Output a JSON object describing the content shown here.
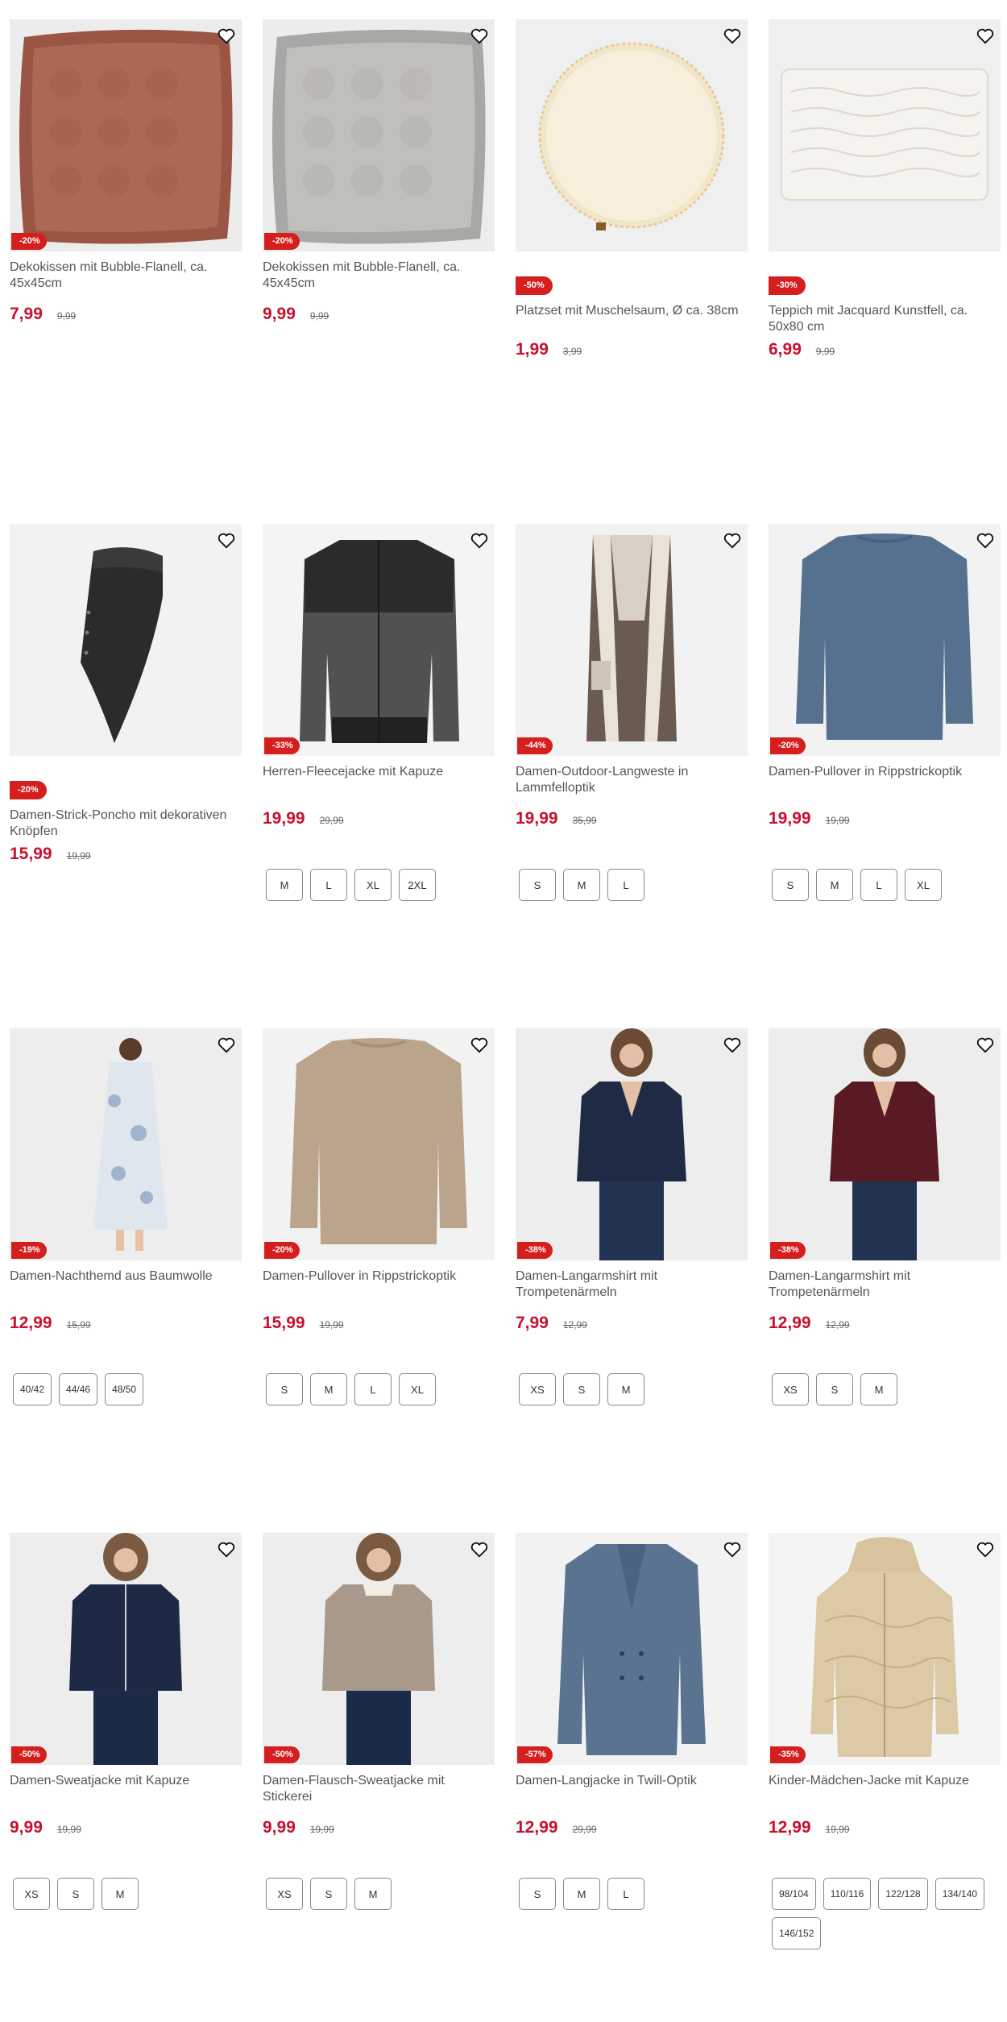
{
  "products": [
    {
      "title": "Dekokissen mit Bubble-Flanell, ca. 45x45cm",
      "badge": "-20%",
      "price": "7,99",
      "old_price": "9,99",
      "sizes": []
    },
    {
      "title": "Dekokissen mit Bubble-Flanell, ca. 45x45cm",
      "badge": "-20%",
      "price": "9,99",
      "old_price": "9,99",
      "sizes": []
    },
    {
      "title": "Platzset mit Muschelsaum, Ø ca. 38cm",
      "badge": "-50%",
      "price": "1,99",
      "old_price": "3,99",
      "sizes": []
    },
    {
      "title": "Teppich mit Jacquard Kunstfell, ca. 50x80 cm",
      "badge": "-30%",
      "price": "6,99",
      "old_price": "9,99",
      "sizes": []
    },
    {
      "title": "Damen-Strick-Poncho mit dekorativen Knöpfen",
      "badge": "-20%",
      "price": "15,99",
      "old_price": "19,99",
      "sizes": []
    },
    {
      "title": "Herren-Fleecejacke mit Kapuze",
      "badge": "-33%",
      "price": "19,99",
      "old_price": "29,99",
      "sizes": [
        "M",
        "L",
        "XL",
        "2XL"
      ]
    },
    {
      "title": "Damen-Outdoor-Langweste in Lammfelloptik",
      "badge": "-44%",
      "price": "19,99",
      "old_price": "35,99",
      "sizes": [
        "S",
        "M",
        "L"
      ]
    },
    {
      "title": "Damen-Pullover in Rippstrickoptik",
      "badge": "-20%",
      "price": "19,99",
      "old_price": "19,99",
      "sizes": [
        "S",
        "M",
        "L",
        "XL"
      ]
    },
    {
      "title": "Damen-Nachthemd aus Baumwolle",
      "badge": "-19%",
      "price": "12,99",
      "old_price": "15,99",
      "sizes": [
        "40/42",
        "44/46",
        "48/50"
      ]
    },
    {
      "title": "Damen-Pullover in Rippstrickoptik",
      "badge": "-20%",
      "price": "15,99",
      "old_price": "19,99",
      "sizes": [
        "S",
        "M",
        "L",
        "XL"
      ]
    },
    {
      "title": "Damen-Langarmshirt mit Trompetenärmeln",
      "badge": "-38%",
      "price": "7,99",
      "old_price": "12,99",
      "sizes": [
        "XS",
        "S",
        "M"
      ]
    },
    {
      "title": "Damen-Langarmshirt mit Trompetenärmeln",
      "badge": "-38%",
      "price": "12,99",
      "old_price": "12,99",
      "sizes": [
        "XS",
        "S",
        "M"
      ]
    },
    {
      "title": "Damen-Sweatjacke mit Kapuze",
      "badge": "-50%",
      "price": "9,99",
      "old_price": "19,99",
      "sizes": [
        "XS",
        "S",
        "M"
      ]
    },
    {
      "title": "Damen-Flausch-Sweatjacke mit Stickerei",
      "badge": "-50%",
      "price": "9,99",
      "old_price": "19,99",
      "sizes": [
        "XS",
        "S",
        "M"
      ]
    },
    {
      "title": "Damen-Langjacke in Twill-Optik",
      "badge": "-57%",
      "price": "12,99",
      "old_price": "29,99",
      "sizes": [
        "S",
        "M",
        "L"
      ]
    },
    {
      "title": "Kinder-Mädchen-Jacke mit Kapuze",
      "badge": "-35%",
      "price": "12,99",
      "old_price": "19,99",
      "sizes": [
        "98/104",
        "110/116",
        "122/128",
        "134/140",
        "146/152"
      ]
    }
  ],
  "colors": {
    "accent": "#c8102e",
    "badge": "#d51f1f"
  },
  "icons": {
    "favorite": "heart-outline-icon"
  }
}
